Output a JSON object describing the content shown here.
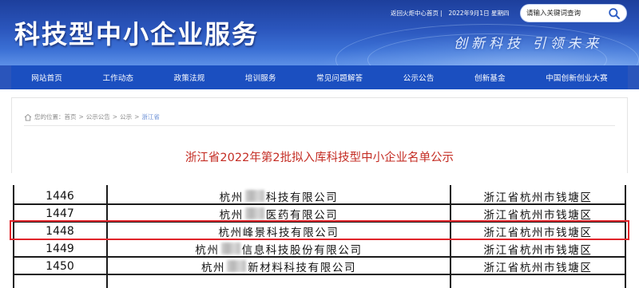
{
  "header": {
    "site_title": "科技型中小企业服务",
    "top_links": {
      "back_home": "返回火炬中心首页",
      "separator": "|",
      "date": "2022年9月1日 星期四"
    },
    "search": {
      "placeholder": "请输入关键词查询",
      "icon": "search-icon"
    },
    "slogan": "创新科技 引领未来"
  },
  "nav": {
    "items": [
      "网站首页",
      "工作动态",
      "政策法规",
      "培训服务",
      "常见问题解答",
      "公示公告",
      "创新基金",
      "中国创新创业大赛"
    ]
  },
  "breadcrumb": {
    "icon": "home-icon",
    "prefix": "您的位置：",
    "items": [
      "首页",
      "公示公告",
      "公示",
      "浙江省"
    ],
    "separator": ">"
  },
  "page_title": "浙江省2022年第2批拟入库科技型中小企业名单公示",
  "table": {
    "rows": [
      {
        "no": "1446",
        "name_prefix": "杭州",
        "name_suffix": "科技有限公司",
        "region": "浙江省杭州市钱塘区"
      },
      {
        "no": "1447",
        "name_prefix": "杭州",
        "name_suffix": "医药有限公司",
        "region": "浙江省杭州市钱塘区"
      },
      {
        "no": "1448",
        "name_prefix": "杭州峰景科技有限公司",
        "name_suffix": "",
        "region": "浙江省杭州市钱塘区"
      },
      {
        "no": "1449",
        "name_prefix": "杭州",
        "name_suffix": "信息科技股份有限公司",
        "region": "浙江省杭州市钱塘区"
      },
      {
        "no": "1450",
        "name_prefix": "杭州",
        "name_suffix": "新材料科技有限公司",
        "region": "浙江省杭州市钱塘区"
      }
    ],
    "highlight_row_no": "1448",
    "colors": {
      "highlight": "#e0242a",
      "title": "#c42d24",
      "nav": "#1b4fc0"
    }
  }
}
